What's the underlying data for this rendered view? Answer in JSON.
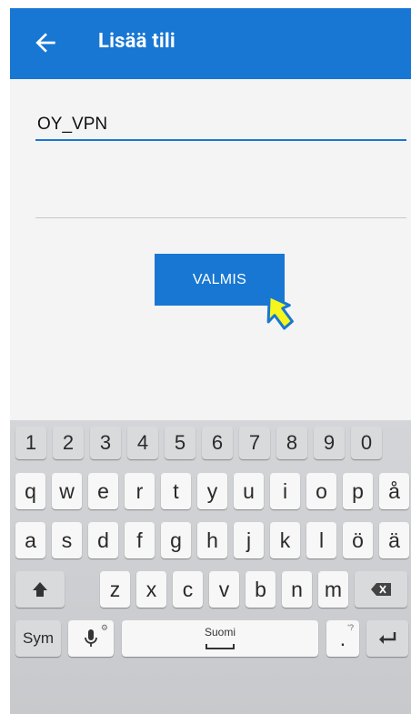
{
  "header": {
    "title": "Lisää tili",
    "back_icon": "arrow-back-icon"
  },
  "form": {
    "account_name_value": "OY_VPN",
    "second_field_value": "",
    "done_button_label": "VALMIS"
  },
  "colors": {
    "primary": "#1877d2",
    "background": "#f4f4f4",
    "keyboard_bg": "#cdcfd2",
    "cursor_fill": "#f6f61c"
  },
  "keyboard": {
    "numbers": [
      "1",
      "2",
      "3",
      "4",
      "5",
      "6",
      "7",
      "8",
      "9",
      "0"
    ],
    "row1": [
      "q",
      "w",
      "e",
      "r",
      "t",
      "y",
      "u",
      "i",
      "o",
      "p",
      "å"
    ],
    "row2": [
      "a",
      "s",
      "d",
      "f",
      "g",
      "h",
      "j",
      "k",
      "l",
      "ö",
      "ä"
    ],
    "row3": [
      "z",
      "x",
      "c",
      "v",
      "b",
      "n",
      "m"
    ],
    "sym_label": "Sym",
    "space_label": "Suomi",
    "shift_icon": "shift-arrow-icon",
    "backspace_icon": "backspace-icon",
    "mic_icon": "microphone-icon",
    "enter_icon": "enter-icon",
    "punct_key": ".",
    "punct_hint": "'?",
    "mic_hint": "⚙"
  }
}
